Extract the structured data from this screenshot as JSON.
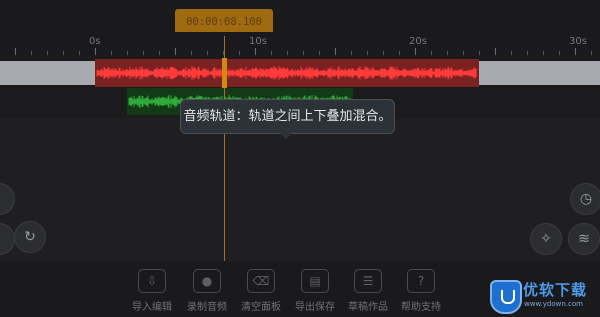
{
  "timecode": "00:00:08.100",
  "ruler": {
    "labels": [
      "0s",
      "10s",
      "20s",
      "30s"
    ]
  },
  "tooltip": {
    "text": "音频轨道：轨道之间上下叠加混合。"
  },
  "toolbar": {
    "items": [
      {
        "label": "导入编辑",
        "icon": "import-icon",
        "glyph": "⇩"
      },
      {
        "label": "录制音频",
        "icon": "microphone-icon",
        "glyph": "●"
      },
      {
        "label": "清空面板",
        "icon": "trash-icon",
        "glyph": "⌫"
      },
      {
        "label": "导出保存",
        "icon": "save-icon",
        "glyph": "▤"
      },
      {
        "label": "草稿作品",
        "icon": "list-icon",
        "glyph": "☰"
      },
      {
        "label": "帮助支持",
        "icon": "help-icon",
        "glyph": "?"
      }
    ]
  },
  "side_buttons": {
    "redo_glyph": "↻",
    "clock_glyph": "◷",
    "magic_glyph": "✧",
    "waveform_glyph": "≋"
  },
  "logo": {
    "brand": "优软下载",
    "domain": "www.ydown.com"
  },
  "colors": {
    "audio_clip": "#7a2222",
    "waveform_red": "#ff3a3a",
    "waveform_green": "#2faa3a",
    "playhead": "#d08a10"
  }
}
